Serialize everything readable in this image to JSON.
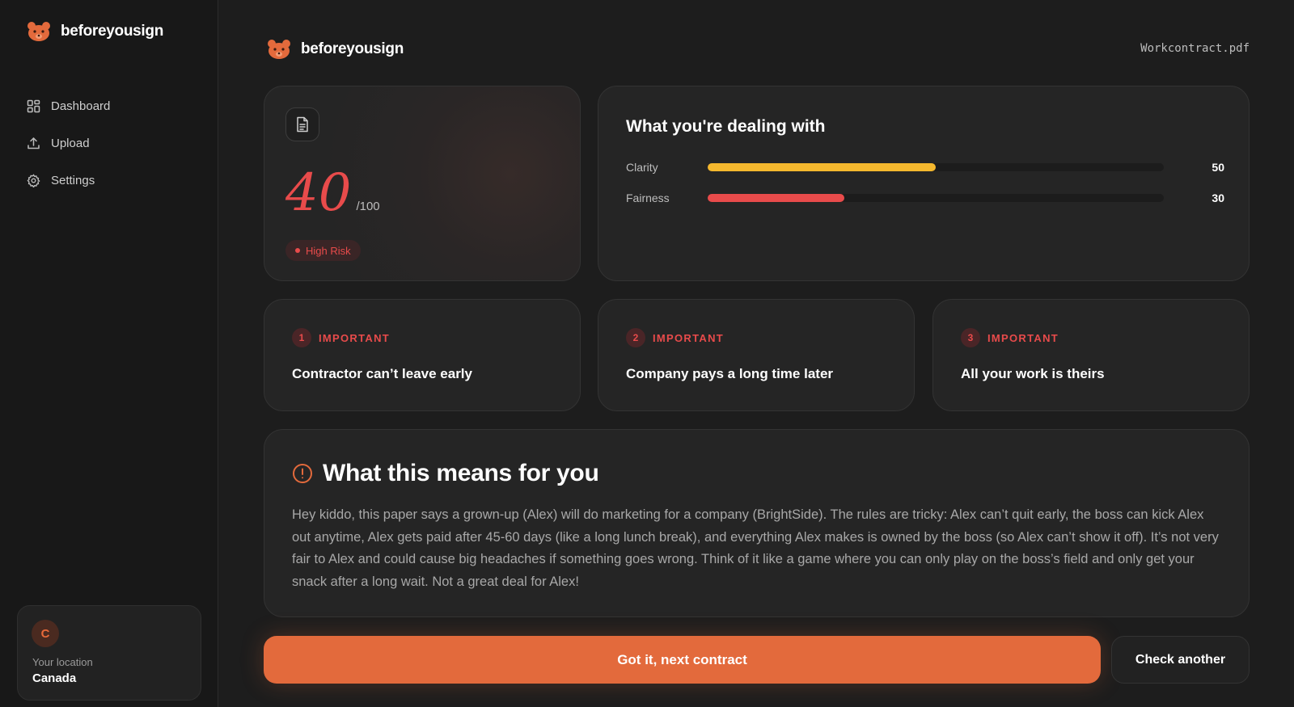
{
  "app": {
    "brand_name": "beforeyousign",
    "logo_icon": "bear-face-icon",
    "accent_color": "#e36a3c"
  },
  "sidebar": {
    "nav": [
      {
        "label": "Dashboard",
        "icon": "grid-icon"
      },
      {
        "label": "Upload",
        "icon": "upload-icon"
      },
      {
        "label": "Settings",
        "icon": "gear-icon"
      }
    ],
    "location": {
      "avatar_letter": "C",
      "label": "Your location",
      "value": "Canada"
    }
  },
  "header": {
    "brand_name": "beforeyousign",
    "filename": "Workcontract.pdf"
  },
  "score": {
    "value": "40",
    "max": "/100",
    "risk_label": "High Risk",
    "risk_color": "#e84b4b"
  },
  "dealing": {
    "title": "What you're dealing with",
    "metrics": [
      {
        "label": "Clarity",
        "value": 50,
        "display": "50",
        "color": "#f5b82e"
      },
      {
        "label": "Fairness",
        "value": 30,
        "display": "30",
        "color": "#e84b4b"
      }
    ]
  },
  "issues": [
    {
      "number": "1",
      "tag": "IMPORTANT",
      "text": "Contractor can’t leave early"
    },
    {
      "number": "2",
      "tag": "IMPORTANT",
      "text": "Company pays a long time later"
    },
    {
      "number": "3",
      "tag": "IMPORTANT",
      "text": "All your work is theirs"
    }
  ],
  "means": {
    "icon": "alert-circle-icon",
    "title": "What this means for you",
    "body": "Hey kiddo, this paper says a grown-up (Alex) will do marketing for a company (BrightSide). The rules are tricky: Alex can’t quit early, the boss can kick Alex out anytime, Alex gets paid after 45-60 days (like a long lunch break), and everything Alex makes is owned by the boss (so Alex can’t show it off). It’s not very fair to Alex and could cause big headaches if something goes wrong. Think of it like a game where you can only play on the boss’s field and only get your snack after a long wait. Not a great deal for Alex!"
  },
  "actions": {
    "primary": "Got it, next contract",
    "secondary": "Check another"
  }
}
